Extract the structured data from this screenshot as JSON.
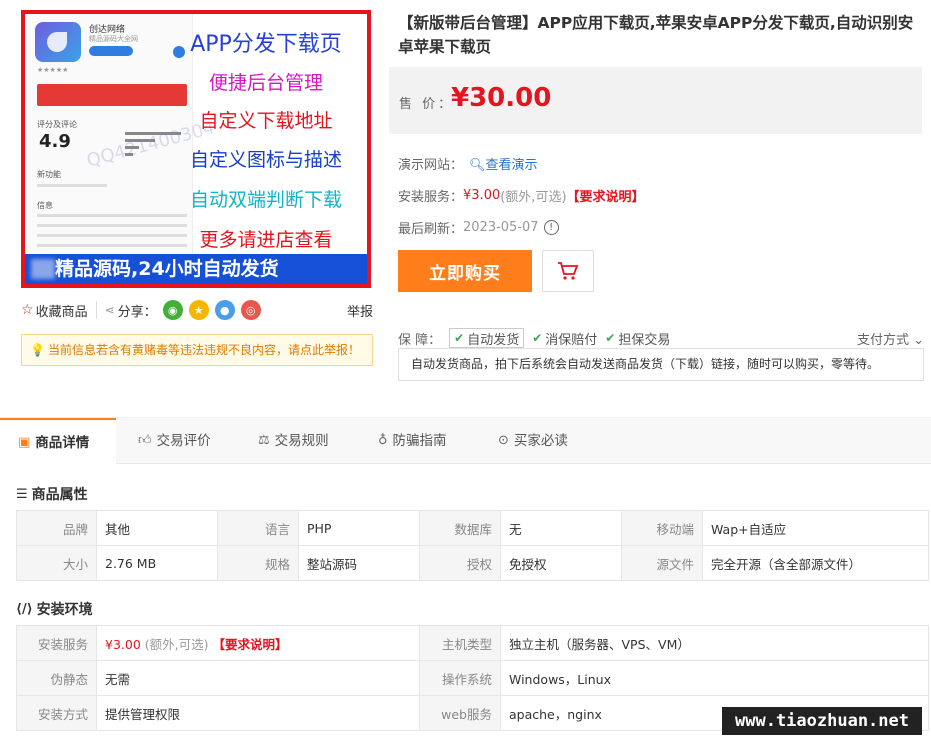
{
  "product_image": {
    "phone_title": "创达网络",
    "phone_sub": "精品源码大全网",
    "phone_rating_label": "评分及评论",
    "phone_score": "4.9",
    "phone_new_label": "新功能",
    "phone_info_label": "信息",
    "watermark": "QQ421400304",
    "promo_lines": [
      "APP分发下载页",
      "便捷后台管理",
      "自定义下载地址",
      "自定义图标与描述",
      "自动双端判断下载",
      "更多请进店查看"
    ],
    "banner": "精品源码,24小时自动发货"
  },
  "share_bar": {
    "favorite": "收藏商品",
    "share": "分享：",
    "report": "举报"
  },
  "warning": "当前信息若含有黄赌毒等违法违规不良内容，请点此举报！",
  "product": {
    "title": "【新版带后台管理】APP应用下载页,苹果安卓APP分发下载页,自动识别安卓苹果下载页",
    "price_label": "售 价：",
    "price": "¥30.00",
    "demo_label": "演示网站：",
    "demo_link": "查看演示",
    "install_label": "安装服务：",
    "install_price": "¥3.00",
    "install_note": "(额外,可选)",
    "install_req": "【要求说明】",
    "refresh_label": "最后刷新：",
    "refresh_date": "2023-05-07",
    "buy_button": "立即购买",
    "guarantee_label": "保 障：",
    "guarantees": [
      "自动发货",
      "消保赔付",
      "担保交易"
    ],
    "pay_method": "支付方式",
    "guarantee_desc": "自动发货商品，拍下后系统会自动发送商品发货（下载）链接，随时可以购买，零等待。"
  },
  "tabs": [
    "商品详情",
    "交易评价",
    "交易规则",
    "防骗指南",
    "买家必读"
  ],
  "attributes": {
    "title": "商品属性",
    "rows": [
      [
        [
          "品牌",
          "其他"
        ],
        [
          "语言",
          "PHP"
        ],
        [
          "数据库",
          "无"
        ],
        [
          "移动端",
          "Wap+自适应"
        ]
      ],
      [
        [
          "大小",
          "2.76 MB"
        ],
        [
          "规格",
          "整站源码"
        ],
        [
          "授权",
          "免授权"
        ],
        [
          "源文件",
          "完全开源（含全部源文件）"
        ]
      ]
    ]
  },
  "environment": {
    "title": "安装环境",
    "install_price": "¥3.00",
    "install_note": "(额外,可选)",
    "install_req": "【要求说明】",
    "rows": [
      [
        [
          "安装服务",
          ""
        ],
        [
          "主机类型",
          "独立主机（服务器、VPS、VM）"
        ]
      ],
      [
        [
          "伪静态",
          "无需"
        ],
        [
          "操作系统",
          "Windows，Linux"
        ]
      ],
      [
        [
          "安装方式",
          "提供管理权限"
        ],
        [
          "web服务",
          "apache，nginx"
        ]
      ]
    ]
  },
  "corner_watermark": "www.tiaozhuan.net"
}
